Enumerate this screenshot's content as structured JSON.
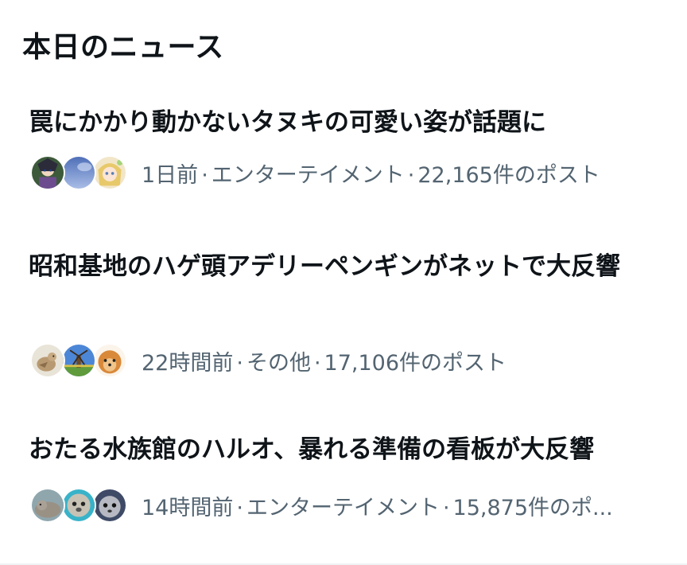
{
  "section": {
    "title": "本日のニュース"
  },
  "news": [
    {
      "headline": "罠にかかり動かないタヌキの可愛い姿が話題に",
      "time": "1日前",
      "category": "エンターテイメント",
      "posts": "22,165件のポスト",
      "separator": "·",
      "avatars": [
        "anime-character-avatar",
        "blue-sky-avatar",
        "illustrated-girl-avatar"
      ]
    },
    {
      "headline": "昭和基地のハゲ頭アデリーペンギンがネットで大反響",
      "time": "22時間前",
      "category": "その他",
      "posts": "17,106件のポスト",
      "separator": "·",
      "avatars": [
        "quail-bird-avatar",
        "windmill-landscape-avatar",
        "pomeranian-dog-avatar"
      ]
    },
    {
      "headline": "おたる水族館のハルオ、暴れる準備の看板が大反響",
      "time": "14時間前",
      "category": "エンターテイメント",
      "posts": "15,875件のポ...",
      "separator": "·",
      "avatars": [
        "seal-avatar",
        "seal-pup-avatar",
        "seal-closeup-avatar"
      ]
    }
  ],
  "colors": {
    "text_primary": "#0f1419",
    "text_secondary": "#536471",
    "divider": "#eff3f4"
  }
}
